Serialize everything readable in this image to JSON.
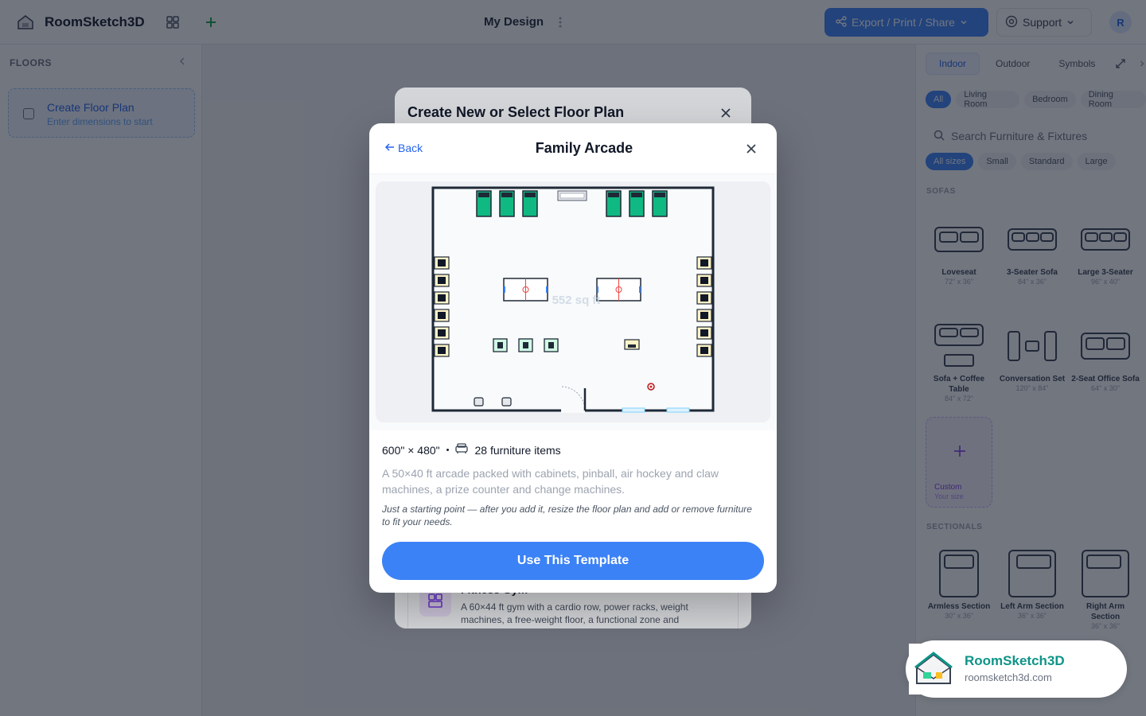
{
  "app": {
    "name": "RoomSketch3D"
  },
  "header": {
    "design_title": "My Design",
    "export_label": "Export / Print / Share",
    "support_label": "Support",
    "avatar_initial": "R"
  },
  "sidebar": {
    "title": "FLOORS",
    "create_plan": {
      "title": "Create Floor Plan",
      "subtitle": "Enter dimensions to start"
    }
  },
  "right_panel": {
    "tabs": [
      "Indoor",
      "Outdoor",
      "Symbols"
    ],
    "active_tab": "Indoor",
    "room_chips": [
      "All",
      "Living Room",
      "Bedroom",
      "Dining Room"
    ],
    "search_placeholder": "Search Furniture & Fixtures",
    "size_chips": [
      "All sizes",
      "Small",
      "Standard",
      "Large"
    ],
    "sections": {
      "sofas": "SOFAS",
      "sectionals": "SECTIONALS"
    },
    "sofas": [
      {
        "name": "Loveseat",
        "size": "72\" x 36\""
      },
      {
        "name": "3-Seater Sofa",
        "size": "84\" x 36\""
      },
      {
        "name": "Large 3-Seater",
        "size": "96\" x 40\""
      },
      {
        "name": "Sofa + Coffee Table",
        "size": "84\" x 72\""
      },
      {
        "name": "Conversation Set",
        "size": "120\" x 84\""
      },
      {
        "name": "2-Seat Office Sofa",
        "size": "64\" x 30\""
      }
    ],
    "custom": {
      "label": "Custom",
      "sub": "Your size"
    },
    "sectionals": [
      {
        "name": "Armless Section",
        "size": "30\" x 36\""
      },
      {
        "name": "Left Arm Section",
        "size": "36\" x 36\""
      },
      {
        "name": "Right Arm Section",
        "size": "36\" x 36\""
      }
    ]
  },
  "bg_modal": {
    "title": "Create New or Select Floor Plan",
    "gym_title": "Fitness Gym",
    "gym_desc": "A 60×44 ft gym with a cardio row, power racks, weight machines, a free-weight floor, a functional zone and"
  },
  "modal": {
    "back_label": "Back",
    "title": "Family Arcade",
    "area_label": "552 sq ft",
    "dimensions": "600\" × 480\"",
    "separator": "•",
    "furniture_count": "28 furniture items",
    "description": "A 50×40 ft arcade packed with cabinets, pinball, air hockey and claw machines, a prize counter and change machines.",
    "note": "Just a starting point — after you add it, resize the floor plan and add or remove furniture to fit your needs.",
    "cta": "Use This Template"
  },
  "brand_card": {
    "name": "RoomSketch3D",
    "url": "roomsketch3d.com"
  },
  "colors": {
    "accent": "#3b82f6",
    "pinball_green": "#10b981",
    "brand_teal": "#0d9488"
  }
}
